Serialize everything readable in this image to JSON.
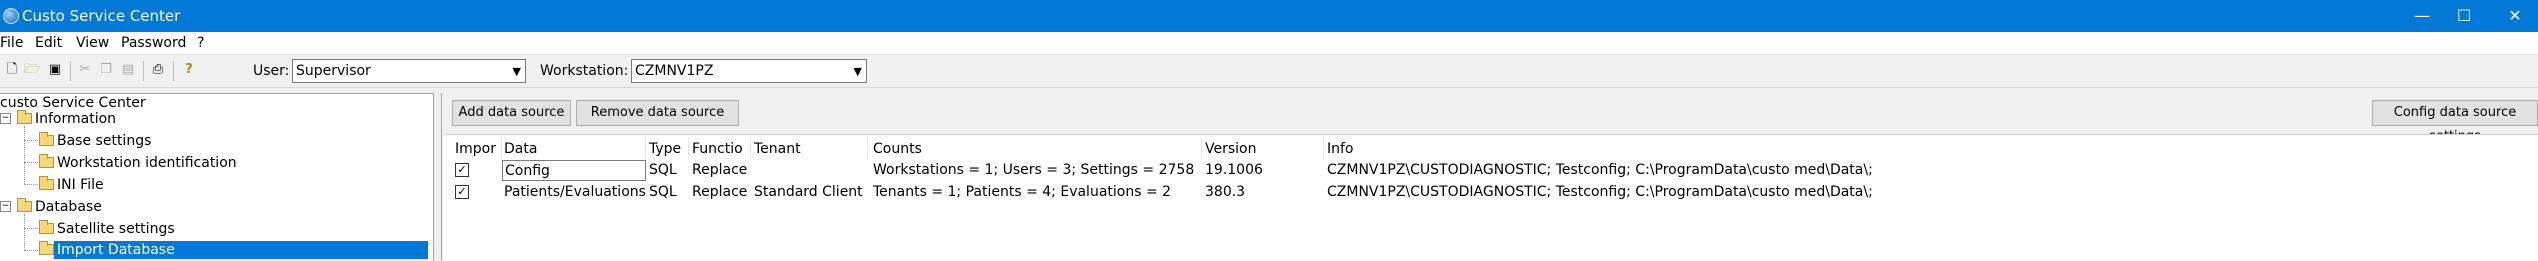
{
  "window": {
    "title": "Custo Service Center",
    "minimize": "—",
    "maximize": "☐",
    "close": "✕"
  },
  "menu": [
    "File",
    "Edit",
    "View",
    "Password",
    "?"
  ],
  "toolbar": {
    "user_label": "User:",
    "user_value": "Supervisor",
    "workstation_label": "Workstation:",
    "workstation_value": "CZMNV1PZ"
  },
  "tree": {
    "root": "custo Service Center",
    "items": [
      {
        "label": "Information"
      },
      {
        "label": "Base settings"
      },
      {
        "label": "Workstation identification"
      },
      {
        "label": "INI File"
      },
      {
        "label": "Database"
      },
      {
        "label": "Satellite settings"
      },
      {
        "label": "Import Database"
      }
    ]
  },
  "buttons": {
    "add": "Add data source",
    "remove": "Remove data source",
    "config": "Config data source settings"
  },
  "grid": {
    "columns": [
      "Impor",
      "Data",
      "Type",
      "Functio",
      "Tenant",
      "Counts",
      "Version",
      "Info"
    ],
    "rows": [
      {
        "checked": "✓",
        "data": "Config",
        "type": "SQL",
        "function": "Replace",
        "tenant": "",
        "counts": "Workstations = 1; Users = 3; Settings = 2758",
        "version": "19.1006",
        "info": "CZMNV1PZ\\CUSTODIAGNOSTIC; Testconfig; C:\\ProgramData\\custo med\\Data\\;"
      },
      {
        "checked": "✓",
        "data": "Patients/Evaluations",
        "type": "SQL",
        "function": "Replace",
        "tenant": "Standard Client",
        "counts": "Tenants = 1; Patients = 4; Evaluations = 2",
        "version": "380.3",
        "info": "CZMNV1PZ\\CUSTODIAGNOSTIC; Testconfig; C:\\ProgramData\\custo med\\Data\\;"
      }
    ]
  }
}
